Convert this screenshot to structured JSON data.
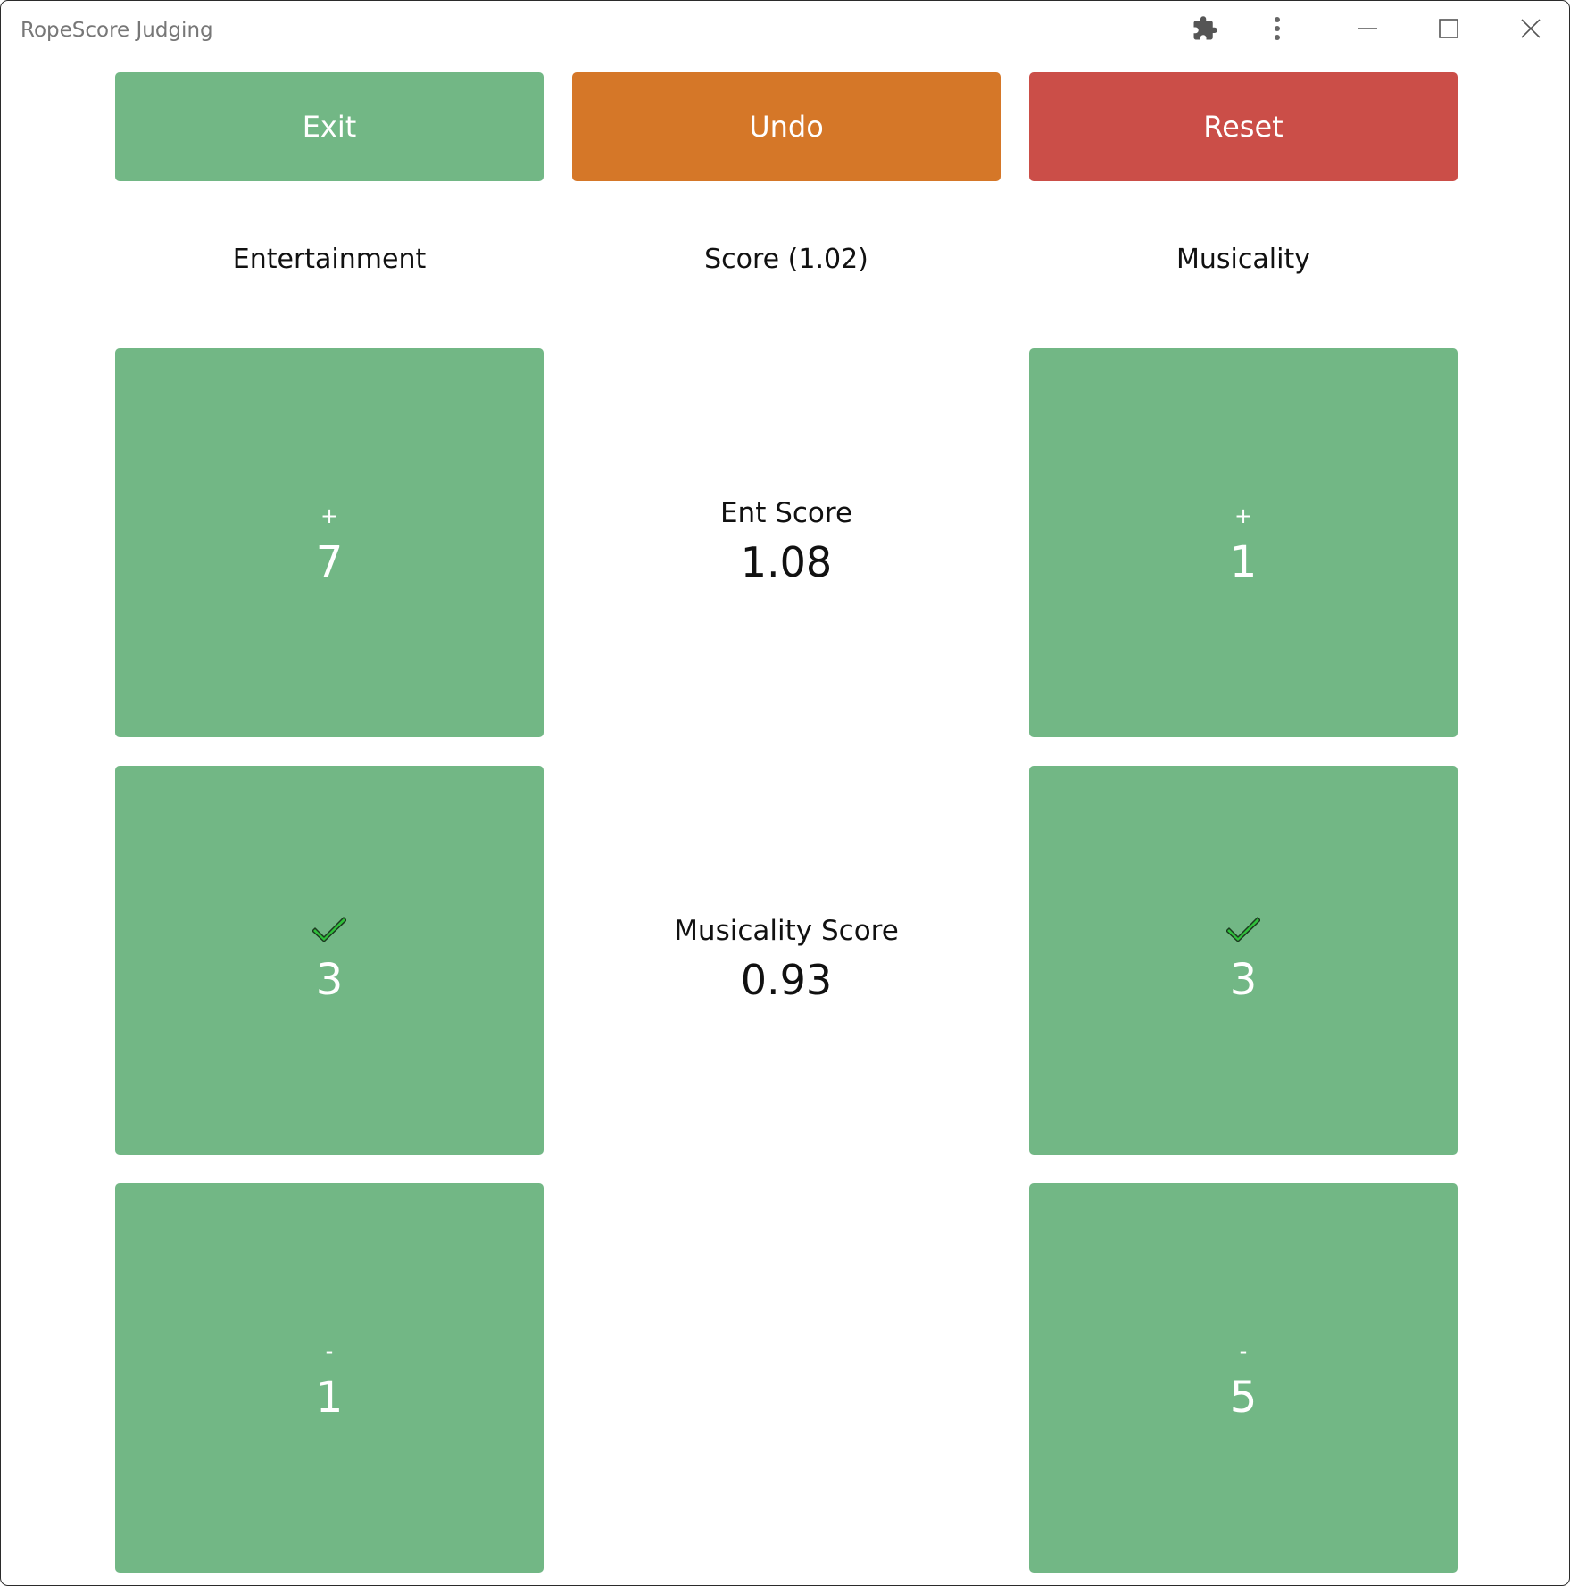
{
  "window": {
    "title": "RopeScore Judging"
  },
  "titlebar_icons": {
    "extensions": "puzzle-piece-icon",
    "menu": "vertical-dots-icon",
    "minimize": "minimize-icon",
    "maximize": "maximize-icon",
    "close": "close-icon"
  },
  "actions": {
    "exit_label": "Exit",
    "undo_label": "Undo",
    "reset_label": "Reset"
  },
  "headers": {
    "left": "Entertainment",
    "center": "Score (1.02)",
    "right": "Musicality"
  },
  "entertainment": {
    "plus": {
      "sign": "+",
      "count": "7"
    },
    "check": {
      "sign_icon": "checkmark-icon",
      "count": "3"
    },
    "minus": {
      "sign": "-",
      "count": "1"
    }
  },
  "musicality": {
    "plus": {
      "sign": "+",
      "count": "1"
    },
    "check": {
      "sign_icon": "checkmark-icon",
      "count": "3"
    },
    "minus": {
      "sign": "-",
      "count": "5"
    }
  },
  "scores": {
    "ent_label": "Ent Score",
    "ent_value": "1.08",
    "mus_label": "Musicality Score",
    "mus_value": "0.93"
  },
  "colors": {
    "tile_green": "#72b785",
    "exit_green": "#72b785",
    "undo_orange": "#d57728",
    "reset_red": "#cb4e48",
    "check_green": "#2fbf3a"
  }
}
